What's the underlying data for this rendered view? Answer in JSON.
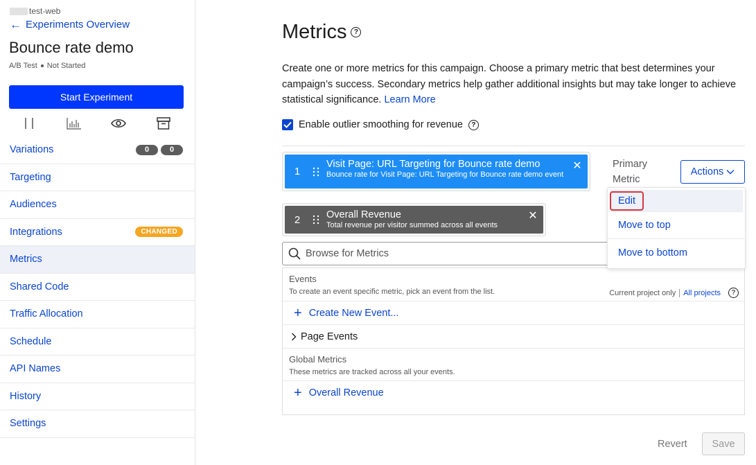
{
  "sidebar": {
    "project_name": "test-web",
    "back_label": "Experiments Overview",
    "experiment_title": "Bounce rate demo",
    "experiment_type": "A/B Test",
    "experiment_status": "Not Started",
    "start_button": "Start Experiment",
    "tools": [
      "pause-icon",
      "results-icon",
      "preview-icon",
      "archive-icon"
    ],
    "variations_counts": [
      "0",
      "0"
    ],
    "changed_badge": "CHANGED",
    "items": [
      {
        "label": "Variations"
      },
      {
        "label": "Targeting"
      },
      {
        "label": "Audiences"
      },
      {
        "label": "Integrations"
      },
      {
        "label": "Metrics"
      },
      {
        "label": "Shared Code"
      },
      {
        "label": "Traffic Allocation"
      },
      {
        "label": "Schedule"
      },
      {
        "label": "API Names"
      },
      {
        "label": "History"
      },
      {
        "label": "Settings"
      }
    ]
  },
  "main": {
    "title": "Metrics",
    "intro_text": "Create one or more metrics for this campaign. Choose a primary metric that best determines your campaign’s success. Secondary metrics help gather additional insights but may take longer to achieve statistical significance.",
    "learn_more": "Learn More",
    "smoothing_label": "Enable outlier smoothing for revenue",
    "primary_label": "Primary Metric",
    "actions_label": "Actions",
    "metrics": [
      {
        "number": "1",
        "name": "Visit Page: URL Targeting for Bounce rate demo",
        "description": "Bounce rate for Visit Page: URL Targeting for Bounce rate demo event",
        "color": "#1d8df5"
      },
      {
        "number": "2",
        "name": "Overall Revenue",
        "description": "Total revenue per visitor summed across all events",
        "color": "#5c5c5c"
      }
    ],
    "dropdown": {
      "edit": "Edit",
      "move_top": "Move to top",
      "move_bottom": "Move to bottom"
    },
    "search_placeholder": "Browse for Metrics",
    "events": {
      "title": "Events",
      "subtitle": "To create an event specific metric, pick an event from the list.",
      "current_project": "Current project only",
      "all_projects": "All projects",
      "create_new": "Create New Event...",
      "page_events": "Page Events"
    },
    "global": {
      "title": "Global Metrics",
      "subtitle": "These metrics are tracked across all your events.",
      "overall_revenue": "Overall Revenue"
    },
    "revert_label": "Revert",
    "save_label": "Save"
  },
  "colors": {
    "link": "#0a45cf",
    "primary_button": "#0037ff",
    "changed_badge": "#f5a623",
    "highlight_box": "#d9363e"
  }
}
